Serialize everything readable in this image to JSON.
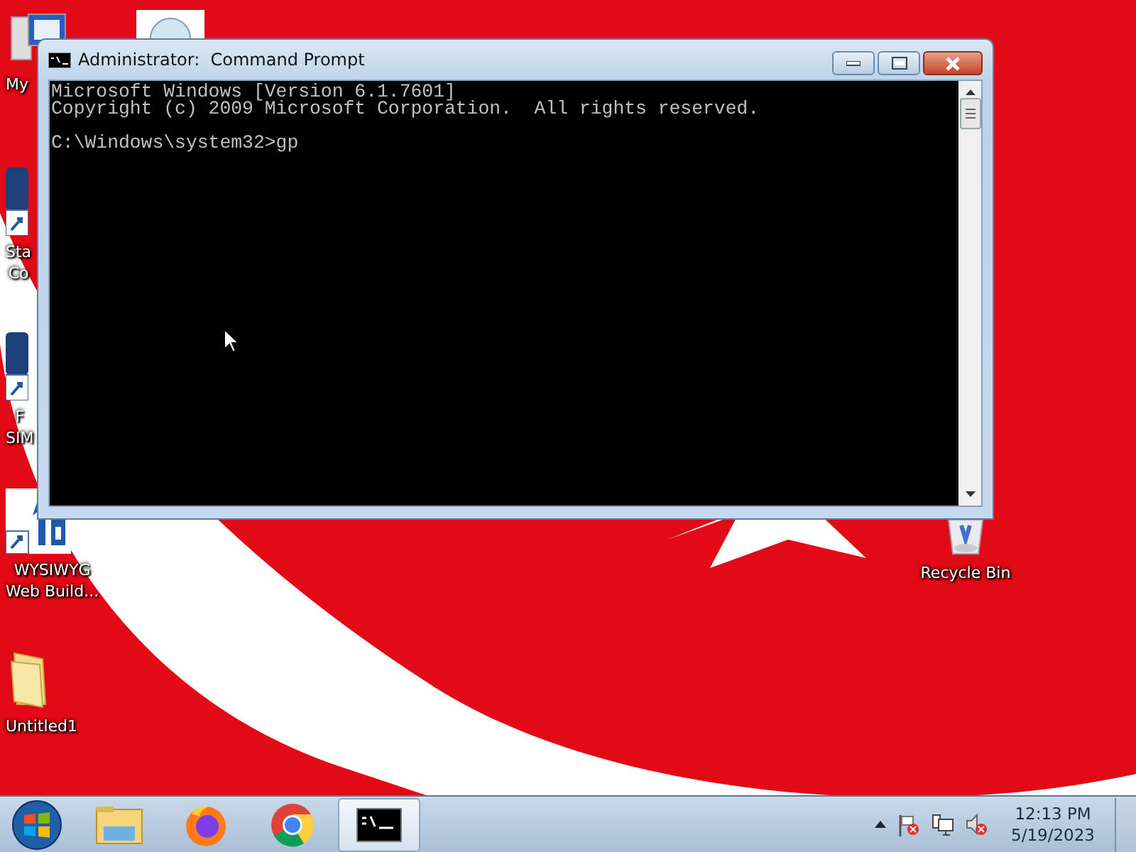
{
  "desktop_icons": [
    {
      "kind": "computer",
      "lines": [
        "My"
      ]
    },
    {
      "kind": "globe"
    },
    {
      "kind": "app",
      "lines": [
        "Sta",
        "Co"
      ]
    },
    {
      "kind": "app",
      "lines": [
        "F",
        "SIM"
      ]
    },
    {
      "kind": "builder",
      "lines": [
        "WYSIWYG",
        "Web Build..."
      ]
    },
    {
      "kind": "folder",
      "lines": [
        "Untitled1"
      ]
    },
    {
      "kind": "recycle",
      "lines": [
        "Recycle Bin"
      ]
    }
  ],
  "window": {
    "title": "Administrator:  Command Prompt",
    "active": true,
    "console_blocks": [
      [
        "Microsoft Windows [Version 6.1.7601]",
        "Copyright (c) 2009 Microsoft Corporation.  All rights reserved."
      ],
      [
        "C:\\Windows\\system32>gp"
      ]
    ]
  },
  "taskbar": {
    "items": [
      {
        "kind": "start",
        "selected": false
      },
      {
        "kind": "explorer",
        "selected": false
      },
      {
        "kind": "firefox",
        "selected": false
      },
      {
        "kind": "chrome",
        "selected": false
      },
      {
        "kind": "console",
        "selected": true
      }
    ],
    "tray": {
      "time": "12:13 PM",
      "date": "5/19/2023"
    }
  }
}
